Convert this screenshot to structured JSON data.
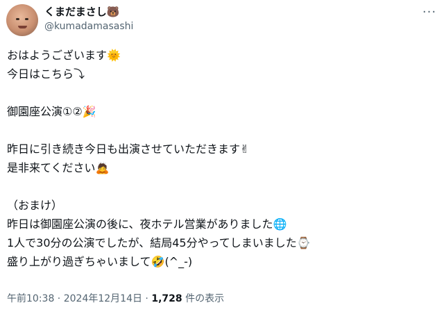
{
  "author": {
    "display_name": "くまだまさし🐻",
    "handle": "@kumadamasashi"
  },
  "tweet": {
    "lines": [
      "おはようございます🌞",
      "今日はこちら⤵",
      "",
      "御園座公演①②🎉",
      "",
      "昨日に引き続き今日も出演させていただきます✌",
      "是非来てください🙇",
      "",
      "（おまけ）",
      "昨日は御園座公演の後に、夜ホテル営業がありました🌐",
      "1人で30分の公演でしたが、結局45分やってしまいました⌚",
      "盛り上がり過ぎちゃいまして🤣(^_-)"
    ]
  },
  "meta": {
    "time": "午前10:38",
    "separator1": " · ",
    "date": "2024年12月14日",
    "separator2": " · ",
    "view_count": "1,728",
    "view_label": " 件の表示"
  },
  "more_icon": "more-horizontal-icon"
}
